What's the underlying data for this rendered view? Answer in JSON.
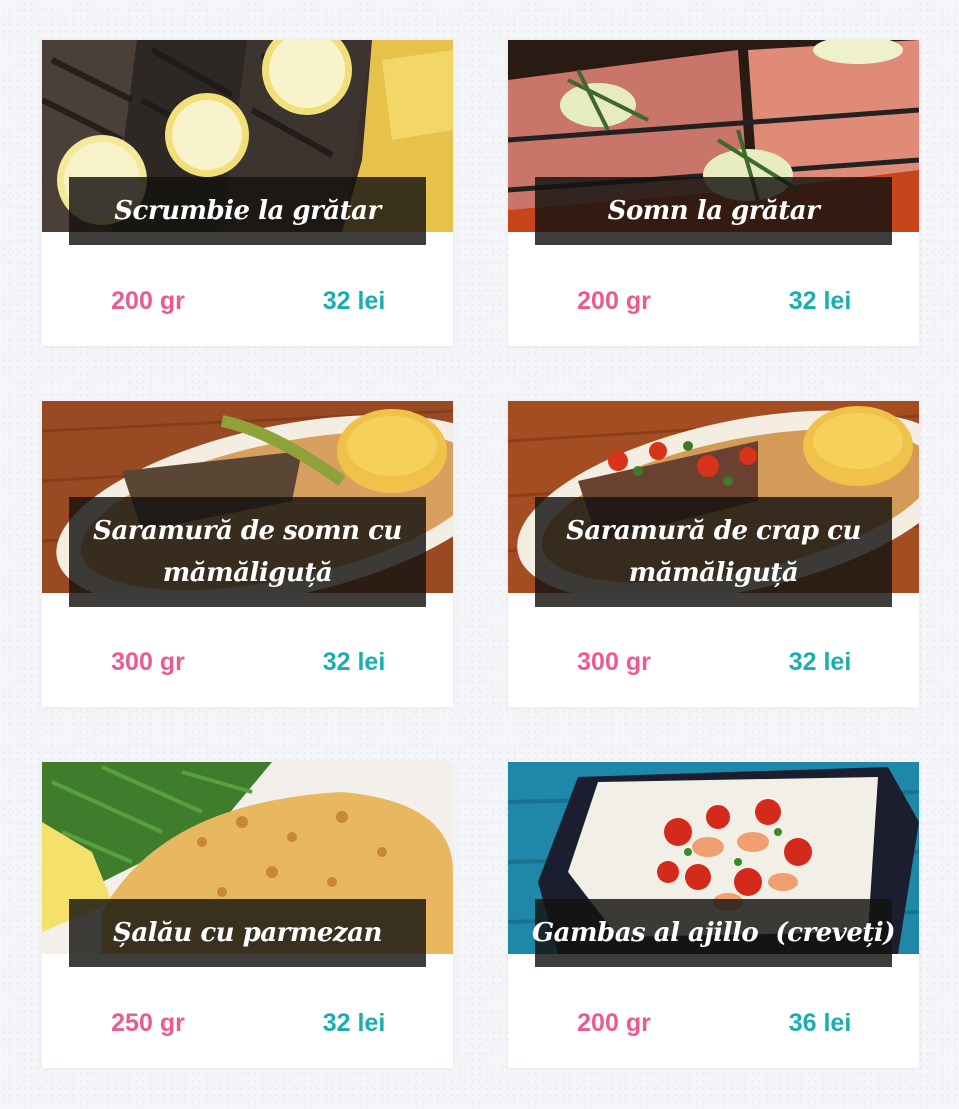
{
  "menu": {
    "items": [
      {
        "title": "Scrumbie la grătar",
        "weight": "200 gr",
        "price": "32 lei",
        "photo_icon": "grilled-mackerel-photo"
      },
      {
        "title": "Somn la grătar",
        "weight": "200 gr",
        "price": "32 lei",
        "photo_icon": "grilled-catfish-photo"
      },
      {
        "title": "Saramură de somn cu mămăliguță",
        "weight": "300 gr",
        "price": "32 lei",
        "photo_icon": "catfish-brine-photo"
      },
      {
        "title": "Saramură de crap cu mămăliguță",
        "weight": "300 gr",
        "price": "32 lei",
        "photo_icon": "carp-brine-photo"
      },
      {
        "title": "Șalău cu parmezan",
        "weight": "250 gr",
        "price": "32 lei",
        "photo_icon": "zander-parmesan-photo"
      },
      {
        "title": "Gambas al ajillo  (creveți)",
        "weight": "200 gr",
        "price": "36 lei",
        "photo_icon": "garlic-shrimp-photo"
      }
    ]
  },
  "colors": {
    "weight": "#ea5b8f",
    "price": "#1aaeae",
    "title_overlay": "#141210",
    "background": "#f5f6fa"
  }
}
